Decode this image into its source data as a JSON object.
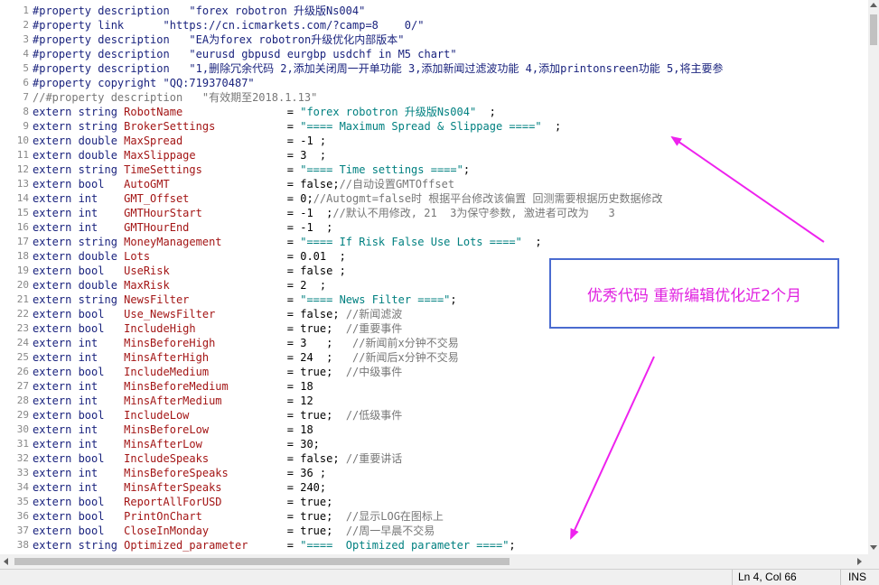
{
  "editor": {
    "lines": [
      {
        "n": "1",
        "seg": [
          {
            "t": "#property description   \"forex robotron 升级版Ns004\"",
            "c": "pp"
          }
        ]
      },
      {
        "n": "2",
        "seg": [
          {
            "t": "#property link      \"https://cn.icmarkets.com/?camp=8    0/\"",
            "c": "pp"
          }
        ]
      },
      {
        "n": "3",
        "seg": [
          {
            "t": "#property description   \"EA为forex robotron升级优化内部版本\"",
            "c": "pp"
          }
        ]
      },
      {
        "n": "4",
        "seg": [
          {
            "t": "#property description   \"eurusd gbpusd eurgbp usdchf in M5 chart\"",
            "c": "pp"
          }
        ]
      },
      {
        "n": "5",
        "seg": [
          {
            "t": "#property description   \"1,删除冗余代码 2,添加关闭周一开单功能 3,添加新闻过滤波功能 4,添加printonsreen功能 5,将主要参",
            "c": "pp"
          }
        ]
      },
      {
        "n": "6",
        "seg": [
          {
            "t": "#property copyright \"QQ:719370487\"",
            "c": "pp"
          }
        ]
      },
      {
        "n": "7",
        "seg": [
          {
            "t": "//#property description   \"有效期至2018.1.13\"",
            "c": "cmt"
          }
        ]
      },
      {
        "n": "8",
        "seg": [
          {
            "t": "extern string ",
            "c": "kw"
          },
          {
            "t": "RobotName                ",
            "c": "idn"
          },
          {
            "t": "= ",
            "c": "op"
          },
          {
            "t": "\"forex robotron 升级版Ns004\"",
            "c": "str"
          },
          {
            "t": "  ;",
            "c": "op"
          }
        ]
      },
      {
        "n": "9",
        "seg": [
          {
            "t": "extern string ",
            "c": "kw"
          },
          {
            "t": "BrokerSettings           ",
            "c": "idn"
          },
          {
            "t": "= ",
            "c": "op"
          },
          {
            "t": "\"==== Maximum Spread & Slippage ====\"",
            "c": "str"
          },
          {
            "t": "  ;",
            "c": "op"
          }
        ]
      },
      {
        "n": "10",
        "seg": [
          {
            "t": "extern double ",
            "c": "kw"
          },
          {
            "t": "MaxSpread                ",
            "c": "idn"
          },
          {
            "t": "= -1 ;",
            "c": "op"
          }
        ]
      },
      {
        "n": "11",
        "seg": [
          {
            "t": "extern double ",
            "c": "kw"
          },
          {
            "t": "MaxSlippage              ",
            "c": "idn"
          },
          {
            "t": "= 3  ;",
            "c": "op"
          }
        ]
      },
      {
        "n": "12",
        "seg": [
          {
            "t": "extern string ",
            "c": "kw"
          },
          {
            "t": "TimeSettings             ",
            "c": "idn"
          },
          {
            "t": "= ",
            "c": "op"
          },
          {
            "t": "\"==== Time settings ====\"",
            "c": "str"
          },
          {
            "t": ";",
            "c": "op"
          }
        ]
      },
      {
        "n": "13",
        "seg": [
          {
            "t": "extern bool   ",
            "c": "kw"
          },
          {
            "t": "AutoGMT                  ",
            "c": "idn"
          },
          {
            "t": "= false;",
            "c": "op"
          },
          {
            "t": "//自动设置GMTOffset",
            "c": "cmt"
          }
        ]
      },
      {
        "n": "14",
        "seg": [
          {
            "t": "extern int    ",
            "c": "kw"
          },
          {
            "t": "GMT_Offset               ",
            "c": "idn"
          },
          {
            "t": "= 0;",
            "c": "op"
          },
          {
            "t": "//Autogmt=false时 根据平台修改该偏置 回测需要根据历史数据修改",
            "c": "cmt"
          }
        ]
      },
      {
        "n": "15",
        "seg": [
          {
            "t": "extern int    ",
            "c": "kw"
          },
          {
            "t": "GMTHourStart             ",
            "c": "idn"
          },
          {
            "t": "= -1  ;",
            "c": "op"
          },
          {
            "t": "//默认不用修改, 21  3为保守参数, 激进者可改为   3",
            "c": "cmt"
          }
        ]
      },
      {
        "n": "16",
        "seg": [
          {
            "t": "extern int    ",
            "c": "kw"
          },
          {
            "t": "GMTHourEnd               ",
            "c": "idn"
          },
          {
            "t": "= -1  ;",
            "c": "op"
          }
        ]
      },
      {
        "n": "17",
        "seg": [
          {
            "t": "extern string ",
            "c": "kw"
          },
          {
            "t": "MoneyManagement          ",
            "c": "idn"
          },
          {
            "t": "= ",
            "c": "op"
          },
          {
            "t": "\"==== If Risk False Use Lots ====\"",
            "c": "str"
          },
          {
            "t": "  ;",
            "c": "op"
          }
        ]
      },
      {
        "n": "18",
        "seg": [
          {
            "t": "extern double ",
            "c": "kw"
          },
          {
            "t": "Lots                     ",
            "c": "idn"
          },
          {
            "t": "= 0.01  ;",
            "c": "op"
          }
        ]
      },
      {
        "n": "19",
        "seg": [
          {
            "t": "extern bool   ",
            "c": "kw"
          },
          {
            "t": "UseRisk                  ",
            "c": "idn"
          },
          {
            "t": "= false ;",
            "c": "op"
          }
        ]
      },
      {
        "n": "20",
        "seg": [
          {
            "t": "extern double ",
            "c": "kw"
          },
          {
            "t": "MaxRisk                  ",
            "c": "idn"
          },
          {
            "t": "= 2  ;",
            "c": "op"
          }
        ]
      },
      {
        "n": "21",
        "seg": [
          {
            "t": "extern string ",
            "c": "kw"
          },
          {
            "t": "NewsFilter               ",
            "c": "idn"
          },
          {
            "t": "= ",
            "c": "op"
          },
          {
            "t": "\"==== News Filter ====\"",
            "c": "str"
          },
          {
            "t": ";",
            "c": "op"
          }
        ]
      },
      {
        "n": "22",
        "seg": [
          {
            "t": "extern bool   ",
            "c": "kw"
          },
          {
            "t": "Use_NewsFilter           ",
            "c": "idn"
          },
          {
            "t": "= false; ",
            "c": "op"
          },
          {
            "t": "//新闻滤波",
            "c": "cmt"
          }
        ]
      },
      {
        "n": "23",
        "seg": [
          {
            "t": "extern bool   ",
            "c": "kw"
          },
          {
            "t": "IncludeHigh              ",
            "c": "idn"
          },
          {
            "t": "= true;  ",
            "c": "op"
          },
          {
            "t": "//重要事件",
            "c": "cmt"
          }
        ]
      },
      {
        "n": "24",
        "seg": [
          {
            "t": "extern int    ",
            "c": "kw"
          },
          {
            "t": "MinsBeforeHigh           ",
            "c": "idn"
          },
          {
            "t": "= 3   ;   ",
            "c": "op"
          },
          {
            "t": "//新闻前x分钟不交易",
            "c": "cmt"
          }
        ]
      },
      {
        "n": "25",
        "seg": [
          {
            "t": "extern int    ",
            "c": "kw"
          },
          {
            "t": "MinsAfterHigh            ",
            "c": "idn"
          },
          {
            "t": "= 24  ;   ",
            "c": "op"
          },
          {
            "t": "//新闻后x分钟不交易",
            "c": "cmt"
          }
        ]
      },
      {
        "n": "26",
        "seg": [
          {
            "t": "extern bool   ",
            "c": "kw"
          },
          {
            "t": "IncludeMedium            ",
            "c": "idn"
          },
          {
            "t": "= true;  ",
            "c": "op"
          },
          {
            "t": "//中级事件",
            "c": "cmt"
          }
        ]
      },
      {
        "n": "27",
        "seg": [
          {
            "t": "extern int    ",
            "c": "kw"
          },
          {
            "t": "MinsBeforeMedium         ",
            "c": "idn"
          },
          {
            "t": "= 18",
            "c": "op"
          }
        ]
      },
      {
        "n": "28",
        "seg": [
          {
            "t": "extern int    ",
            "c": "kw"
          },
          {
            "t": "MinsAfterMedium          ",
            "c": "idn"
          },
          {
            "t": "= 12",
            "c": "op"
          }
        ]
      },
      {
        "n": "29",
        "seg": [
          {
            "t": "extern bool   ",
            "c": "kw"
          },
          {
            "t": "IncludeLow               ",
            "c": "idn"
          },
          {
            "t": "= true;  ",
            "c": "op"
          },
          {
            "t": "//低级事件",
            "c": "cmt"
          }
        ]
      },
      {
        "n": "30",
        "seg": [
          {
            "t": "extern int    ",
            "c": "kw"
          },
          {
            "t": "MinsBeforeLow            ",
            "c": "idn"
          },
          {
            "t": "= 18",
            "c": "op"
          }
        ]
      },
      {
        "n": "31",
        "seg": [
          {
            "t": "extern int    ",
            "c": "kw"
          },
          {
            "t": "MinsAfterLow             ",
            "c": "idn"
          },
          {
            "t": "= 30;",
            "c": "op"
          }
        ]
      },
      {
        "n": "32",
        "seg": [
          {
            "t": "extern bool   ",
            "c": "kw"
          },
          {
            "t": "IncludeSpeaks            ",
            "c": "idn"
          },
          {
            "t": "= false; ",
            "c": "op"
          },
          {
            "t": "//重要讲话",
            "c": "cmt"
          }
        ]
      },
      {
        "n": "33",
        "seg": [
          {
            "t": "extern int    ",
            "c": "kw"
          },
          {
            "t": "MinsBeforeSpeaks         ",
            "c": "idn"
          },
          {
            "t": "= 36 ;",
            "c": "op"
          }
        ]
      },
      {
        "n": "34",
        "seg": [
          {
            "t": "extern int    ",
            "c": "kw"
          },
          {
            "t": "MinsAfterSpeaks          ",
            "c": "idn"
          },
          {
            "t": "= 240;",
            "c": "op"
          }
        ]
      },
      {
        "n": "35",
        "seg": [
          {
            "t": "extern bool   ",
            "c": "kw"
          },
          {
            "t": "ReportAllForUSD          ",
            "c": "idn"
          },
          {
            "t": "= true;",
            "c": "op"
          }
        ]
      },
      {
        "n": "36",
        "seg": [
          {
            "t": "extern bool   ",
            "c": "kw"
          },
          {
            "t": "PrintOnChart             ",
            "c": "idn"
          },
          {
            "t": "= true;  ",
            "c": "op"
          },
          {
            "t": "//显示LOG在图标上",
            "c": "cmt"
          }
        ]
      },
      {
        "n": "37",
        "seg": [
          {
            "t": "extern bool   ",
            "c": "kw"
          },
          {
            "t": "CloseInMonday            ",
            "c": "idn"
          },
          {
            "t": "= true;  ",
            "c": "op"
          },
          {
            "t": "//周一早晨不交易",
            "c": "cmt"
          }
        ]
      },
      {
        "n": "38",
        "seg": [
          {
            "t": "extern string ",
            "c": "kw"
          },
          {
            "t": "Optimized_parameter      ",
            "c": "idn"
          },
          {
            "t": "= ",
            "c": "op"
          },
          {
            "t": "\"====  Optimized parameter ====\"",
            "c": "str"
          },
          {
            "t": ";",
            "c": "op"
          }
        ]
      }
    ]
  },
  "annotation": {
    "text": "优秀代码 重新编辑优化近2个月",
    "color": "#e020e0",
    "border_color": "#4a6bd0"
  },
  "status_bar": {
    "position": "Ln 4, Col 66",
    "mode": "INS"
  },
  "colors": {
    "keyword": "#1a237e",
    "identifier": "#a31515",
    "string": "#008080",
    "comment": "#777777",
    "arrow": "#ee22ee"
  }
}
